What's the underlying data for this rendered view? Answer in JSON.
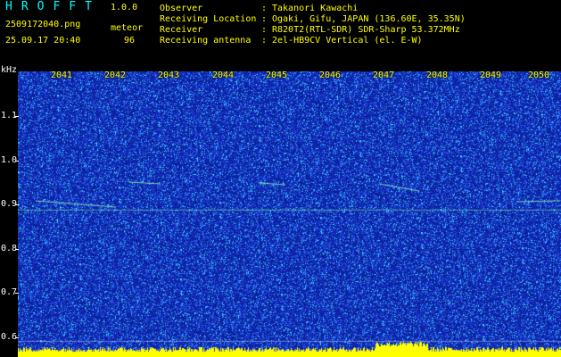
{
  "header": {
    "app_name": "HROFFT",
    "version": "1.0.0",
    "filename": "2509172040.png",
    "datetime": "25.09.17 20:40",
    "meteor_label": "meteor",
    "meteor_count": "96"
  },
  "info": [
    {
      "key": "Observer",
      "sep": ":",
      "value": "Takanori Kawachi"
    },
    {
      "key": "Receiving Location",
      "sep": ":",
      "value": "Ogaki, Gifu, JAPAN (136.60E, 35.35N)"
    },
    {
      "key": "Receiver",
      "sep": ":",
      "value": "R820T2(RTL-SDR) SDR-Sharp 53.372MHz"
    },
    {
      "key": "Receiving antenna",
      "sep": ":",
      "value": "2el-HB9CV Vertical (el. E-W)"
    }
  ],
  "axis": {
    "unit": "kHz",
    "yticks": [
      "1.1",
      "1.0",
      "0.9",
      "0.8",
      "0.7",
      "0.6"
    ],
    "time_labels": [
      "2041",
      "2042",
      "2043",
      "2044",
      "2045",
      "2046",
      "2047",
      "2048",
      "2049",
      "2050"
    ]
  },
  "colors": {
    "background": "#0c1f9a",
    "noise_dark": "#1430c8",
    "noise_mid": "#2f6bff",
    "noise_light": "#38e0ff",
    "signal": "#7fffa0",
    "header_text": "#ffff00",
    "title_text": "#00ffff"
  },
  "chart_data": {
    "type": "heatmap",
    "ylabel": "kHz",
    "ylim": [
      0.58,
      1.2
    ],
    "yticks": [
      1.1,
      1.0,
      0.9,
      0.8,
      0.7,
      0.6
    ],
    "x": [
      "2041",
      "2042",
      "2043",
      "2044",
      "2045",
      "2046",
      "2047",
      "2048",
      "2049",
      "2050"
    ],
    "carrier_frequency_khz": 0.9,
    "meteor_count": 96
  }
}
